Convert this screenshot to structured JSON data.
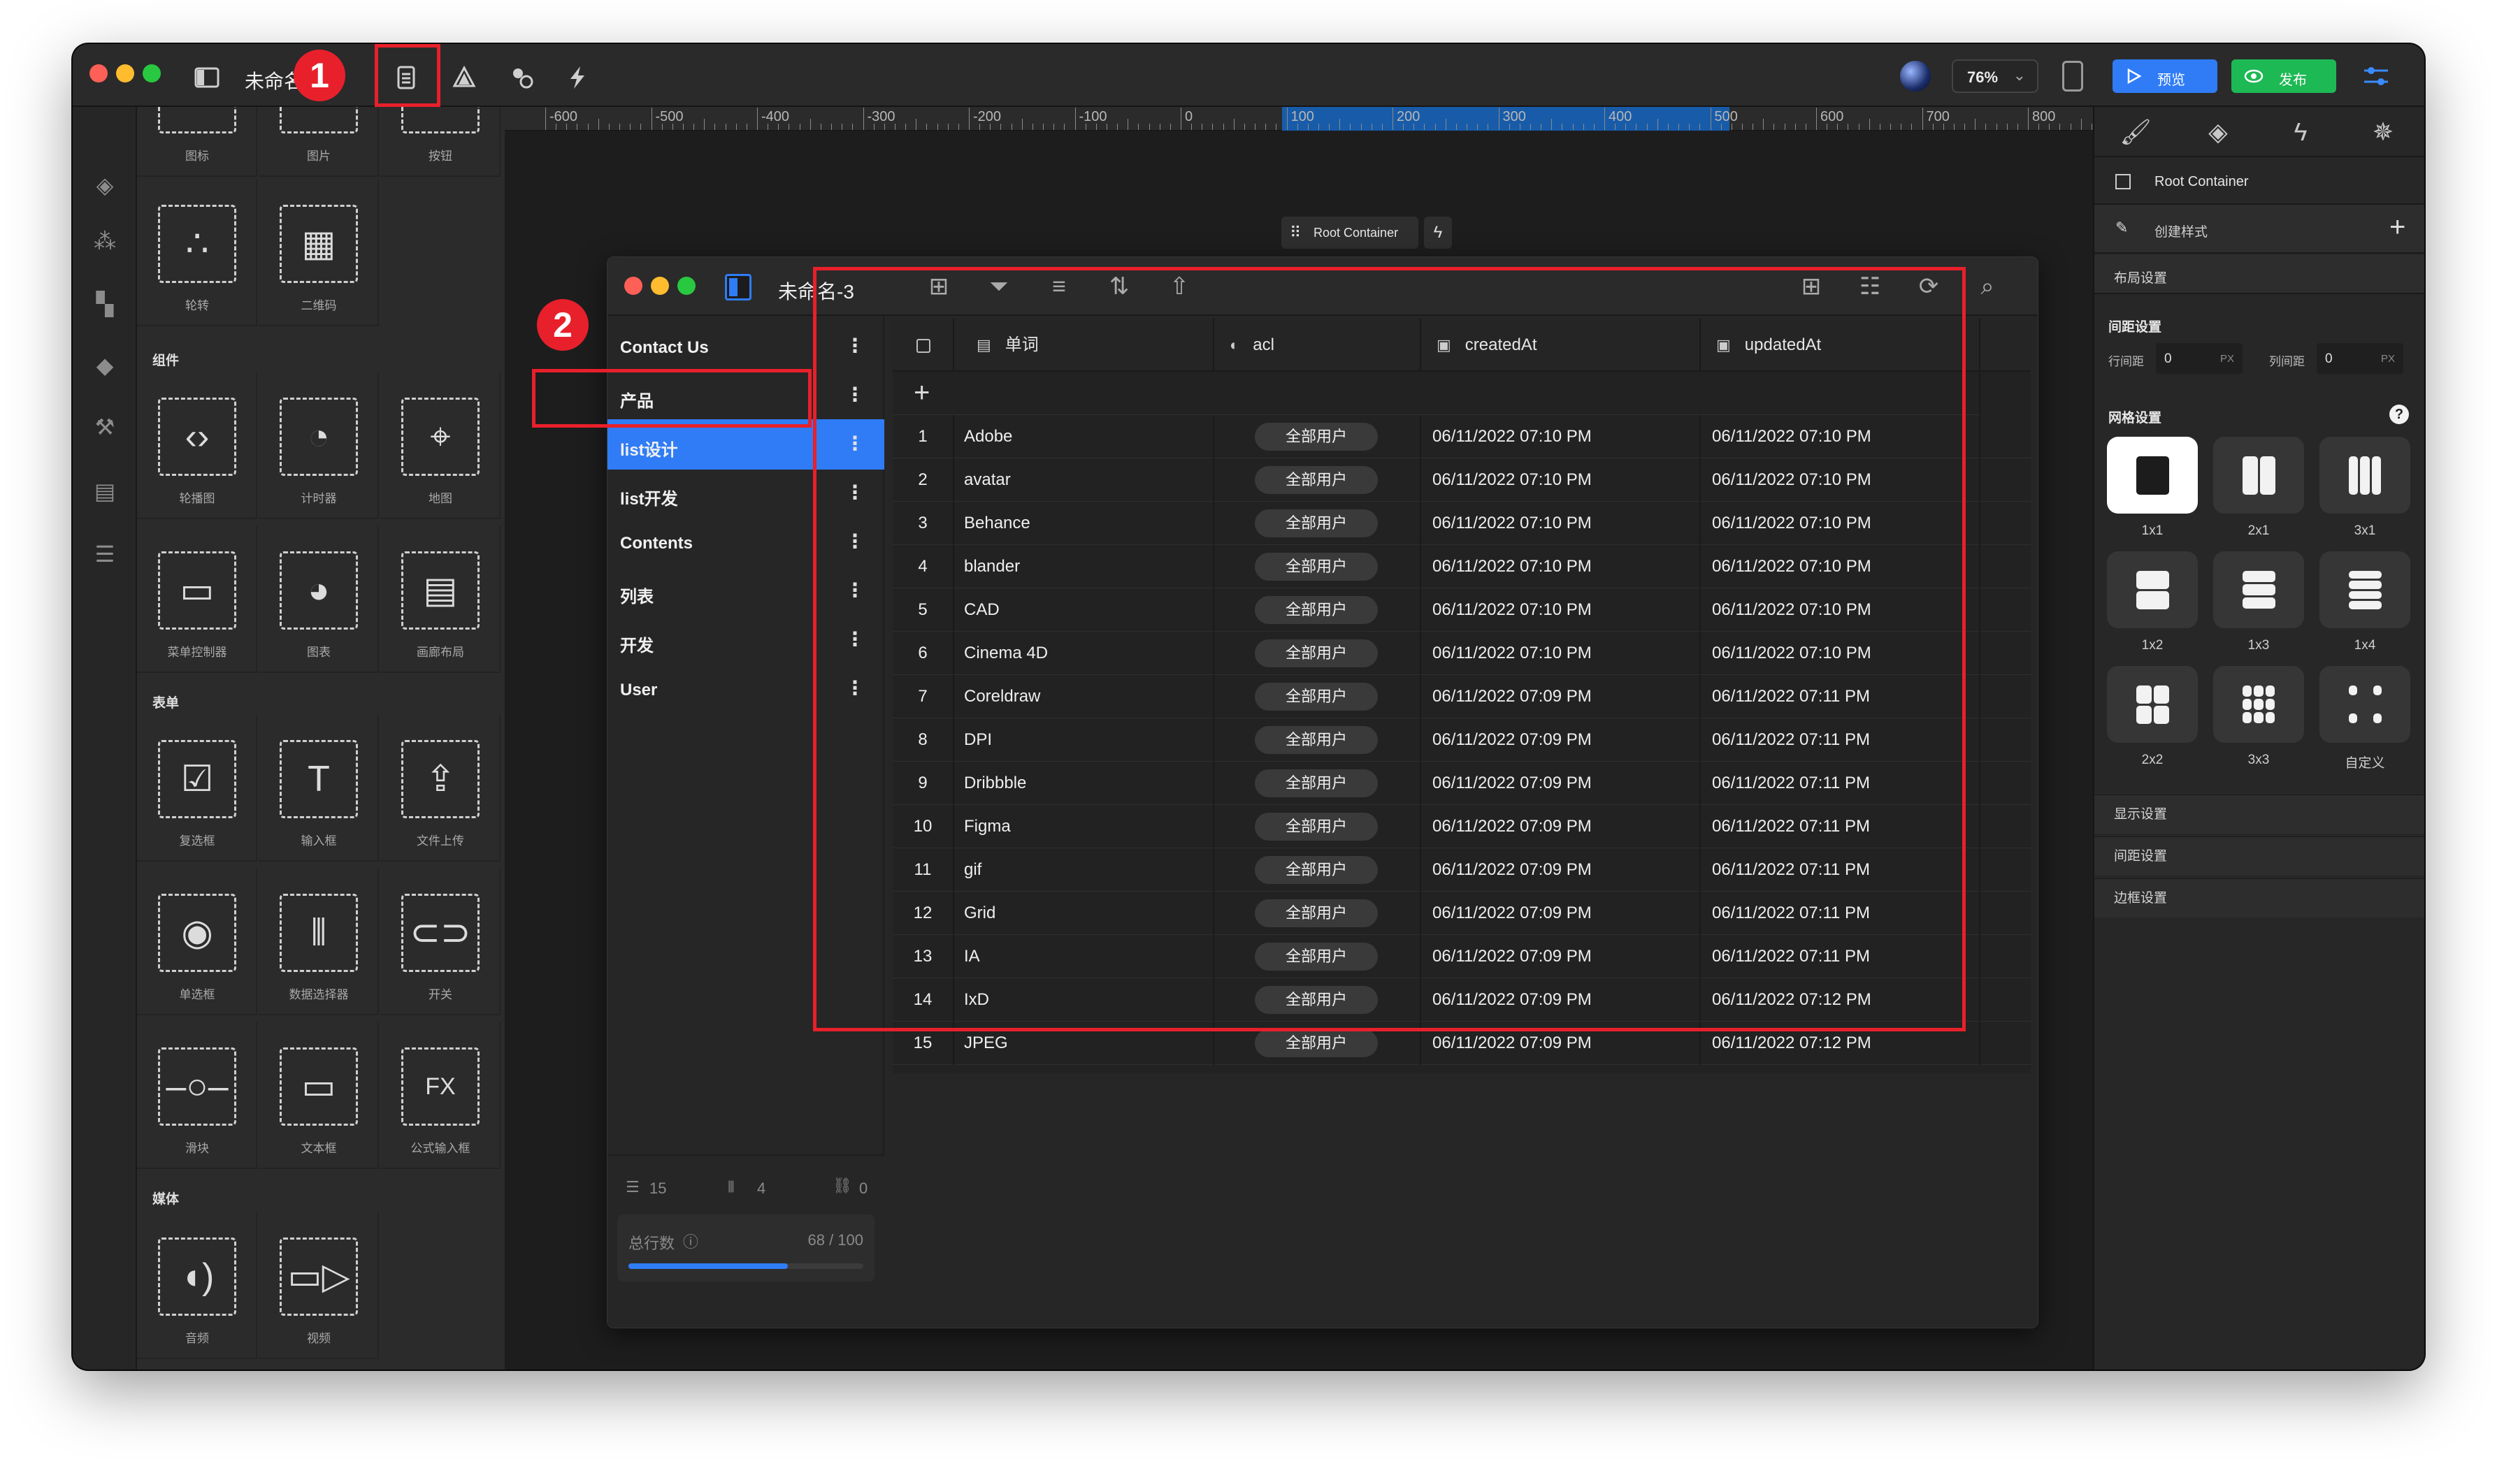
{
  "toolbar": {
    "doc_title": "未命名",
    "zoom": "76%",
    "preview_label": "预览",
    "publish_label": "发布"
  },
  "markers": {
    "m1": "1",
    "m2": "2"
  },
  "components": {
    "top_labels": [
      "图标",
      "图片",
      "按钮"
    ],
    "row1": [
      {
        "label": "轮转",
        "icon": "dots-icon"
      },
      {
        "label": "二维码",
        "icon": "qrcode-icon"
      }
    ],
    "section_components": "组件",
    "row2": [
      {
        "label": "轮播图",
        "icon": "carousel-icon"
      },
      {
        "label": "计时器",
        "icon": "timer-icon"
      },
      {
        "label": "地图",
        "icon": "map-pin-icon"
      }
    ],
    "row3": [
      {
        "label": "菜单控制器",
        "icon": "menu-controller-icon"
      },
      {
        "label": "图表",
        "icon": "pie-chart-icon"
      },
      {
        "label": "画廊布局",
        "icon": "gallery-layout-icon"
      }
    ],
    "section_form": "表单",
    "row4": [
      {
        "label": "复选框",
        "icon": "checkbox-icon"
      },
      {
        "label": "输入框",
        "icon": "text-input-icon"
      },
      {
        "label": "文件上传",
        "icon": "upload-icon"
      }
    ],
    "row5": [
      {
        "label": "单选框",
        "icon": "radio-icon"
      },
      {
        "label": "数据选择器",
        "icon": "data-picker-icon"
      },
      {
        "label": "开关",
        "icon": "toggle-icon"
      }
    ],
    "row6": [
      {
        "label": "滑块",
        "icon": "slider-icon"
      },
      {
        "label": "文本框",
        "icon": "textarea-icon"
      },
      {
        "label": "公式输入框",
        "icon": "formula-icon"
      }
    ],
    "section_media": "媒体",
    "row7": [
      {
        "label": "音频",
        "icon": "audio-icon"
      },
      {
        "label": "视频",
        "icon": "video-icon"
      }
    ]
  },
  "ruler": {
    "labels": [
      "-600",
      "-500",
      "-400",
      "-300",
      "-200",
      "-100",
      "0",
      "100",
      "200",
      "300",
      "400",
      "500",
      "600",
      "700",
      "800"
    ]
  },
  "canvas": {
    "root_chip": "Root Container"
  },
  "app": {
    "title": "未命名-3",
    "tables": [
      {
        "name": "Contact Us"
      },
      {
        "name": "产品"
      },
      {
        "name": "list设计"
      },
      {
        "name": "list开发"
      },
      {
        "name": "Contents"
      },
      {
        "name": "列表"
      },
      {
        "name": "开发"
      },
      {
        "name": "User"
      }
    ],
    "active_table": 2,
    "footer": {
      "rows": "15",
      "cols": "4",
      "links": "0",
      "total_label": "总行数",
      "total_value": "68 / 100"
    },
    "total_progress": 0.68
  },
  "grid": {
    "columns": [
      "单词",
      "acl",
      "createdAt",
      "updatedAt"
    ],
    "rows": [
      {
        "n": "1",
        "word": "Adobe",
        "acl": "全部用户",
        "created": "06/11/2022 07:10 PM",
        "updated": "06/11/2022 07:10 PM"
      },
      {
        "n": "2",
        "word": "avatar",
        "acl": "全部用户",
        "created": "06/11/2022 07:10 PM",
        "updated": "06/11/2022 07:10 PM"
      },
      {
        "n": "3",
        "word": "Behance",
        "acl": "全部用户",
        "created": "06/11/2022 07:10 PM",
        "updated": "06/11/2022 07:10 PM"
      },
      {
        "n": "4",
        "word": "blander",
        "acl": "全部用户",
        "created": "06/11/2022 07:10 PM",
        "updated": "06/11/2022 07:10 PM"
      },
      {
        "n": "5",
        "word": "CAD",
        "acl": "全部用户",
        "created": "06/11/2022 07:10 PM",
        "updated": "06/11/2022 07:10 PM"
      },
      {
        "n": "6",
        "word": "Cinema 4D",
        "acl": "全部用户",
        "created": "06/11/2022 07:10 PM",
        "updated": "06/11/2022 07:10 PM"
      },
      {
        "n": "7",
        "word": "Coreldraw",
        "acl": "全部用户",
        "created": "06/11/2022 07:09 PM",
        "updated": "06/11/2022 07:11 PM"
      },
      {
        "n": "8",
        "word": "DPI",
        "acl": "全部用户",
        "created": "06/11/2022 07:09 PM",
        "updated": "06/11/2022 07:11 PM"
      },
      {
        "n": "9",
        "word": "Dribbble",
        "acl": "全部用户",
        "created": "06/11/2022 07:09 PM",
        "updated": "06/11/2022 07:11 PM"
      },
      {
        "n": "10",
        "word": "Figma",
        "acl": "全部用户",
        "created": "06/11/2022 07:09 PM",
        "updated": "06/11/2022 07:11 PM"
      },
      {
        "n": "11",
        "word": "gif",
        "acl": "全部用户",
        "created": "06/11/2022 07:09 PM",
        "updated": "06/11/2022 07:11 PM"
      },
      {
        "n": "12",
        "word": "Grid",
        "acl": "全部用户",
        "created": "06/11/2022 07:09 PM",
        "updated": "06/11/2022 07:11 PM"
      },
      {
        "n": "13",
        "word": "IA",
        "acl": "全部用户",
        "created": "06/11/2022 07:09 PM",
        "updated": "06/11/2022 07:11 PM"
      },
      {
        "n": "14",
        "word": "IxD",
        "acl": "全部用户",
        "created": "06/11/2022 07:09 PM",
        "updated": "06/11/2022 07:12 PM"
      },
      {
        "n": "15",
        "word": "JPEG",
        "acl": "全部用户",
        "created": "06/11/2022 07:09 PM",
        "updated": "06/11/2022 07:12 PM"
      }
    ]
  },
  "inspector": {
    "selected_name": "Root Container",
    "create_style": "创建样式",
    "layout_settings": "布局设置",
    "spacing_title": "间距设置",
    "row_gap_label": "行间距",
    "row_gap_value": "0",
    "col_gap_label": "列间距",
    "col_gap_value": "0",
    "unit": "PX",
    "grid_settings": "网格设置",
    "help": "?",
    "grid_options": [
      "1x1",
      "2x1",
      "3x1",
      "1x2",
      "1x3",
      "1x4",
      "2x2",
      "3x3",
      "自定义"
    ],
    "sections": [
      "显示设置",
      "间距设置",
      "边框设置"
    ]
  },
  "colors": {
    "accent_blue": "#2f7cf6",
    "publish_green": "#1db954",
    "annotation_red": "#e8202b"
  }
}
